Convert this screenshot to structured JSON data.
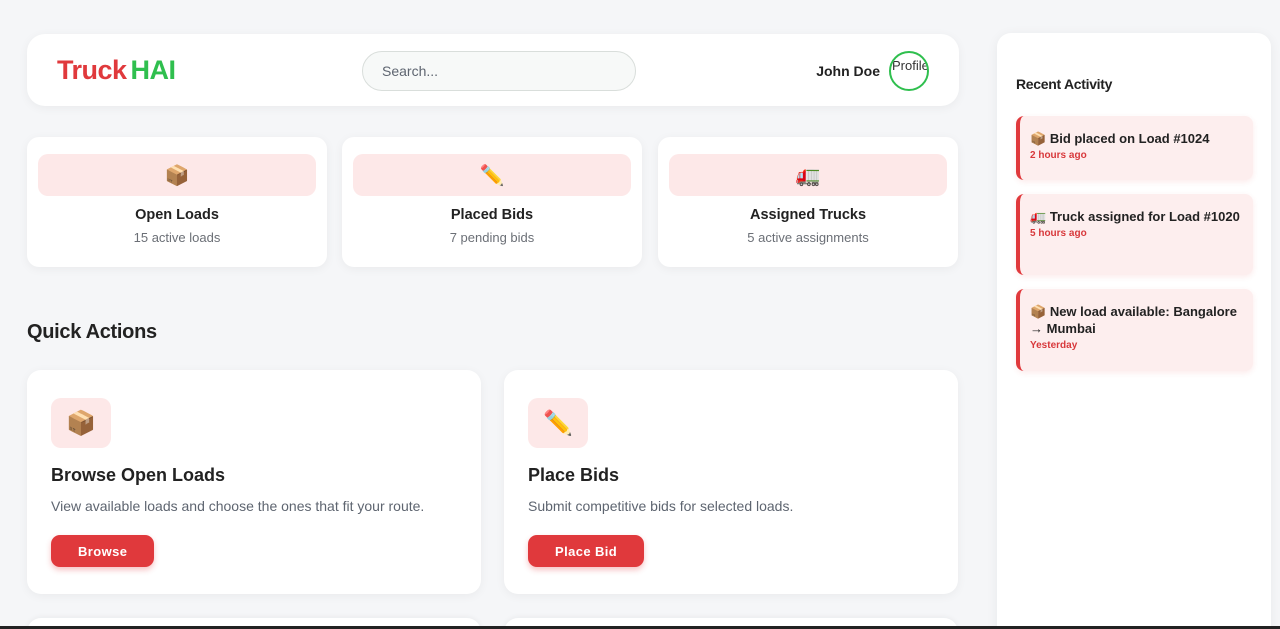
{
  "brand": {
    "part1": "Truck",
    "part2": "HAI"
  },
  "search": {
    "placeholder": "Search..."
  },
  "user": {
    "name": "John Doe",
    "avatar_alt": "Profile"
  },
  "stats": [
    {
      "icon": "📦",
      "icon_name": "package-icon",
      "title": "Open Loads",
      "subtitle": "15 active loads"
    },
    {
      "icon": "✏️",
      "icon_name": "pencil-icon",
      "title": "Placed Bids",
      "subtitle": "7 pending bids"
    },
    {
      "icon": "🚛",
      "icon_name": "truck-icon",
      "title": "Assigned Trucks",
      "subtitle": "5 active assignments"
    }
  ],
  "quick_actions": {
    "title": "Quick Actions",
    "items": [
      {
        "icon": "📦",
        "icon_name": "package-icon",
        "title": "Browse Open Loads",
        "description": "View available loads and choose the ones that fit your route.",
        "button": "Browse"
      },
      {
        "icon": "✏️",
        "icon_name": "pencil-icon",
        "title": "Place Bids",
        "description": "Submit competitive bids for selected loads.",
        "button": "Place Bid"
      }
    ]
  },
  "recent_activity": {
    "title": "Recent Activity",
    "items": [
      {
        "icon": "📦",
        "text": "Bid placed on Load #1024",
        "time": "2 hours ago"
      },
      {
        "icon": "🚛",
        "text": "Truck assigned for Load #1020",
        "time": "5 hours ago"
      },
      {
        "icon": "📦",
        "text": "New load available: Bangalore → Mumbai",
        "time": "Yesterday"
      }
    ]
  },
  "colors": {
    "brand_red": "#e0393c",
    "brand_green": "#2fbf4e",
    "accent_bg": "#fde8e8"
  }
}
